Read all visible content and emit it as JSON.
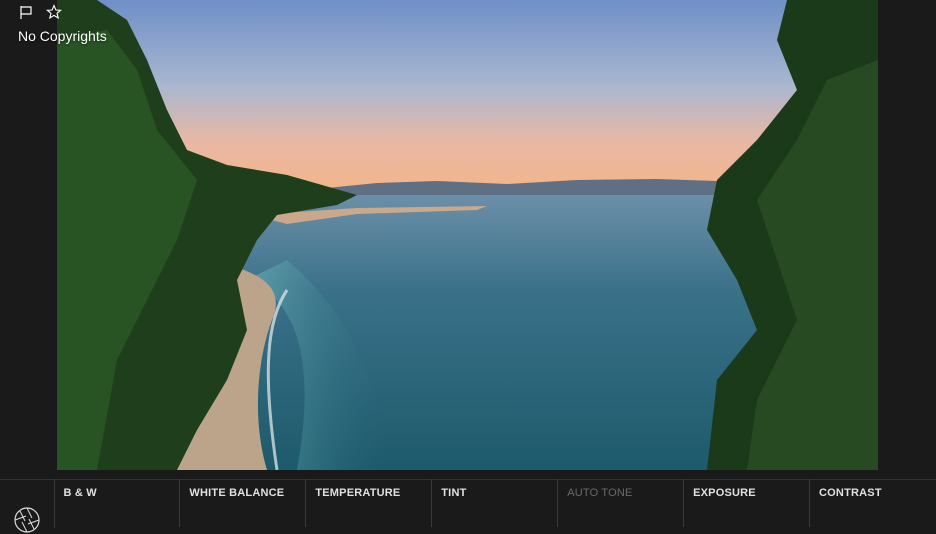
{
  "photo": {
    "description_icon": "landscape-photo"
  },
  "header": {
    "flag_icon": "flag-icon",
    "star_icon": "star-icon",
    "copyright_label": "No Copyrights"
  },
  "toolbar": {
    "logo_icon": "aperture-icon",
    "tools": [
      {
        "label": "B & W",
        "enabled": true
      },
      {
        "label": "WHITE BALANCE",
        "enabled": true
      },
      {
        "label": "TEMPERATURE",
        "enabled": true
      },
      {
        "label": "TINT",
        "enabled": true
      },
      {
        "label": "AUTO TONE",
        "enabled": false
      },
      {
        "label": "EXPOSURE",
        "enabled": true
      },
      {
        "label": "CONTRAST",
        "enabled": true
      }
    ]
  },
  "colors": {
    "background": "#1a1a1a",
    "text": "#e0e0e0",
    "disabled_text": "#6a6a6a",
    "divider": "#3a3a3a"
  }
}
